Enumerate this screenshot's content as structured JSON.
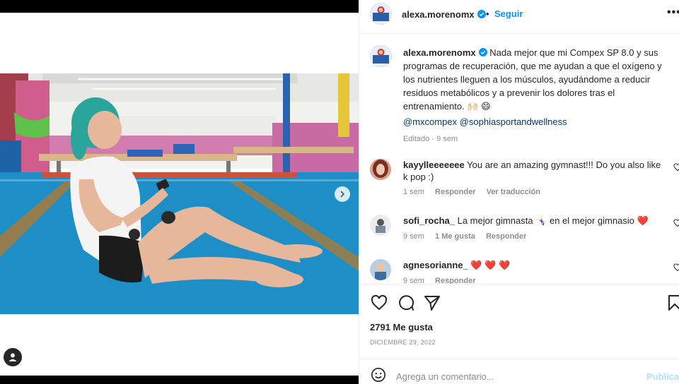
{
  "post": {
    "username": "alexa.morenomx",
    "follow_label": "Seguir",
    "separator": "•",
    "more_label": "•••"
  },
  "caption": {
    "username": "alexa.morenomx",
    "text": "Nada mejor que mi Compex SP 8.0 y sus programas de recuperación, que me ayudan a que el oxígeno y los nutrientes lleguen a los músculos, ayudándome a reducir residuos metabólicos y a prevenir los dolores tras el entrenamiento. 🙌🏻 😄",
    "mention_1": "@mxcompex",
    "mention_2": "@sophiasportandwellness",
    "edited": "Editado",
    "dot": "·",
    "time": "9 sem"
  },
  "comments": [
    {
      "username": "kayylleeeeeee",
      "text": "You are an amazing gymnast!!! Do you also like k pop :)",
      "time": "1 sem",
      "reply": "Responder",
      "translate": "Ver traducción"
    },
    {
      "username": "sofi_rocha_",
      "text": "La mejor gimnasta 🤸🏻‍♀️ en el mejor gimnasio ❤️",
      "time": "9 sem",
      "likes": "1 Me gusta",
      "reply": "Responder"
    },
    {
      "username": "agnesorianne_",
      "text": "❤️ ❤️ ❤️",
      "time": "9 sem",
      "reply": "Responder"
    }
  ],
  "stats": {
    "likes": "2791 Me gusta",
    "date": "DICIEMBRE 29, 2022"
  },
  "add_comment": {
    "placeholder": "Agrega un comentario...",
    "publish": "Publicar"
  },
  "colors": {
    "link": "#0095f6",
    "mention": "#00376b",
    "muted": "#8e8e8e",
    "verified": "#0095f6",
    "heart_red": "#ed4956",
    "mat_blue": "#1e8fc6"
  },
  "icons": {
    "like": "heart-icon",
    "comment": "comment-icon",
    "share": "share-icon",
    "save": "bookmark-icon",
    "emoji": "emoji-icon",
    "verified": "verified-badge-icon",
    "next": "chevron-right-icon",
    "tag": "user-tag-icon"
  }
}
